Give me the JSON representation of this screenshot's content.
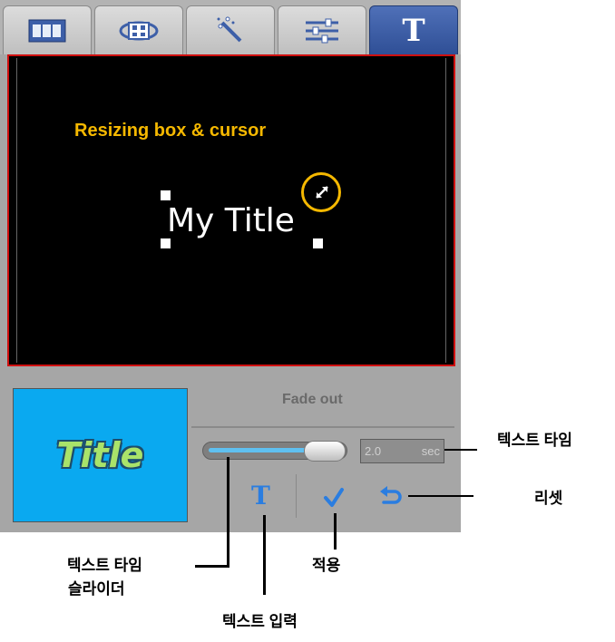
{
  "tabs": [
    {
      "icon": "film-icon"
    },
    {
      "icon": "transition-icon"
    },
    {
      "icon": "magic-wand-icon"
    },
    {
      "icon": "adjust-sliders-icon"
    },
    {
      "icon": "text-icon",
      "letter": "T",
      "active": true
    }
  ],
  "preview": {
    "callout": "Resizing box & cursor",
    "title_text": "My Title"
  },
  "thumbnail": {
    "text": "Title"
  },
  "effect": {
    "label": "Fade out"
  },
  "text_time": {
    "value": "2.0",
    "unit": "sec",
    "slider_fraction": 0.75
  },
  "buttons": {
    "text_input_letter": "T"
  },
  "annotations": {
    "text_time": "텍스트 타임",
    "reset": "리셋",
    "slider_line1": "텍스트 타임",
    "slider_line2": "슬라이더",
    "apply": "적용",
    "text_input": "텍스트 입력"
  },
  "colors": {
    "accent": "#2a7de0",
    "highlight": "#f5b800",
    "border_red": "#d01010"
  }
}
